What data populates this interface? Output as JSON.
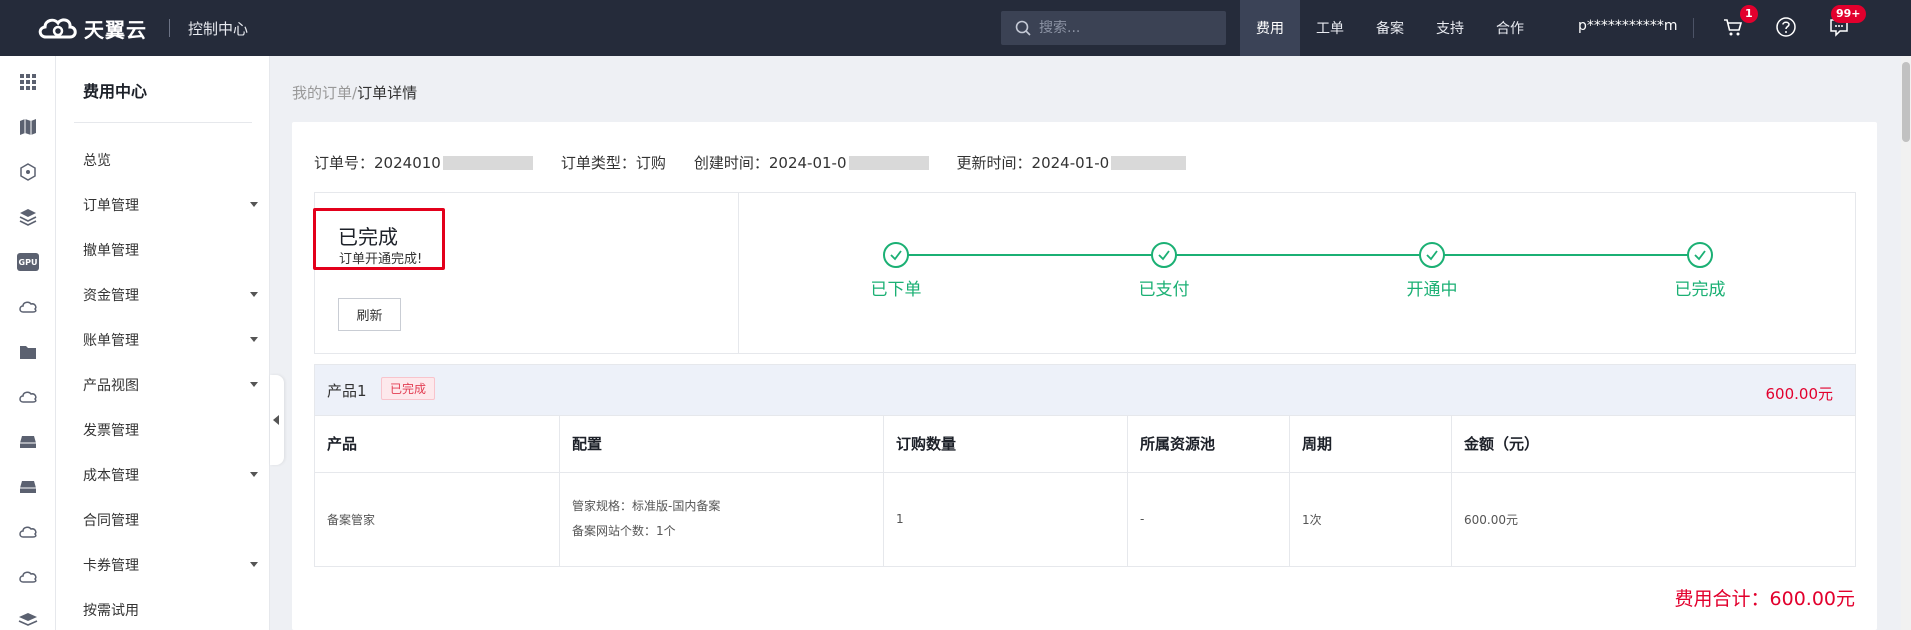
{
  "header": {
    "logo_text": "天翼云",
    "console_title": "控制中心",
    "search_placeholder": "搜索...",
    "nav": [
      "费用",
      "工单",
      "备案",
      "支持",
      "合作"
    ],
    "user": "p***********m",
    "cart_badge": "1",
    "msg_badge": "99+"
  },
  "rail": {
    "icons": [
      "grid-icon",
      "map-icon",
      "cube-network-icon",
      "layers-icon",
      "gpu-icon",
      "cloud-icon",
      "folder-icon",
      "cloud-icon",
      "server-icon",
      "server-icon",
      "cloud-icon",
      "cloud-icon",
      "stack-icon"
    ],
    "gpu_label": "GPU"
  },
  "sidebar": {
    "title": "费用中心",
    "items": [
      {
        "label": "总览",
        "expand": false
      },
      {
        "label": "订单管理",
        "expand": true
      },
      {
        "label": "撤单管理",
        "expand": false
      },
      {
        "label": "资金管理",
        "expand": true
      },
      {
        "label": "账单管理",
        "expand": true
      },
      {
        "label": "产品视图",
        "expand": true
      },
      {
        "label": "发票管理",
        "expand": false
      },
      {
        "label": "成本管理",
        "expand": true
      },
      {
        "label": "合同管理",
        "expand": false
      },
      {
        "label": "卡券管理",
        "expand": true
      },
      {
        "label": "按需试用",
        "expand": false
      }
    ]
  },
  "breadcrumb": {
    "parent": "我的订单",
    "sep": "/",
    "current": "订单详情"
  },
  "order": {
    "no_label": "订单号：",
    "no_value": "2024010",
    "type_label": "订单类型：",
    "type_value": "订购",
    "created_label": "创建时间：",
    "created_value": "2024-01-0",
    "updated_label": "更新时间：",
    "updated_value": "2024-01-0"
  },
  "status": {
    "title": "已完成",
    "subtitle": "订单开通完成!",
    "refresh": "刷新",
    "steps": [
      "已下单",
      "已支付",
      "开通中",
      "已完成"
    ]
  },
  "product": {
    "name": "产品1",
    "badge": "已完成",
    "amount": "600.00元",
    "columns": [
      "产品",
      "配置",
      "订购数量",
      "所属资源池",
      "周期",
      "金额（元）"
    ],
    "row": {
      "product": "备案管家",
      "config": [
        "管家规格：标准版-国内备案",
        "备案网站个数：1个"
      ],
      "qty": "1",
      "pool": "-",
      "period": "1次",
      "amount": "600.00元"
    }
  },
  "total": "费用合计：600.00元"
}
